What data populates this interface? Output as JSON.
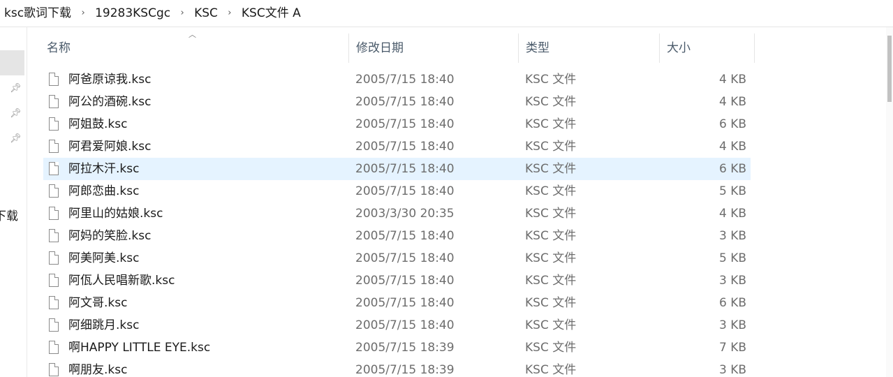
{
  "breadcrumb": {
    "items": [
      "ksc歌词下载",
      "19283KSCgc",
      "KSC",
      "KSC文件 A"
    ],
    "separator": "›"
  },
  "nav": {
    "partial_label": "下载"
  },
  "columns": {
    "name": "名称",
    "date": "修改日期",
    "type": "类型",
    "size": "大小"
  },
  "files": [
    {
      "name": "阿爸原谅我.ksc",
      "date": "2005/7/15 18:40",
      "type": "KSC 文件",
      "size": "4 KB"
    },
    {
      "name": "阿公的酒碗.ksc",
      "date": "2005/7/15 18:40",
      "type": "KSC 文件",
      "size": "4 KB"
    },
    {
      "name": "阿姐鼓.ksc",
      "date": "2005/7/15 18:40",
      "type": "KSC 文件",
      "size": "6 KB"
    },
    {
      "name": "阿君爱阿娘.ksc",
      "date": "2005/7/15 18:40",
      "type": "KSC 文件",
      "size": "4 KB"
    },
    {
      "name": "阿拉木汗.ksc",
      "date": "2005/7/15 18:40",
      "type": "KSC 文件",
      "size": "6 KB",
      "selected": true
    },
    {
      "name": "阿郎恋曲.ksc",
      "date": "2005/7/15 18:40",
      "type": "KSC 文件",
      "size": "5 KB"
    },
    {
      "name": "阿里山的姑娘.ksc",
      "date": "2003/3/30 20:35",
      "type": "KSC 文件",
      "size": "4 KB"
    },
    {
      "name": "阿妈的笑脸.ksc",
      "date": "2005/7/15 18:40",
      "type": "KSC 文件",
      "size": "3 KB"
    },
    {
      "name": "阿美阿美.ksc",
      "date": "2005/7/15 18:40",
      "type": "KSC 文件",
      "size": "5 KB"
    },
    {
      "name": "阿佤人民唱新歌.ksc",
      "date": "2005/7/15 18:40",
      "type": "KSC 文件",
      "size": "3 KB"
    },
    {
      "name": "阿文哥.ksc",
      "date": "2005/7/15 18:40",
      "type": "KSC 文件",
      "size": "6 KB"
    },
    {
      "name": "阿细跳月.ksc",
      "date": "2005/7/15 18:40",
      "type": "KSC 文件",
      "size": "3 KB"
    },
    {
      "name": "啊HAPPY LITTLE EYE.ksc",
      "date": "2005/7/15 18:39",
      "type": "KSC 文件",
      "size": "7 KB"
    },
    {
      "name": "啊朋友.ksc",
      "date": "2005/7/15 18:39",
      "type": "KSC 文件",
      "size": "3 KB"
    }
  ],
  "icons": {
    "file": "document-icon",
    "pin": "pin-icon",
    "sort": "sort-up-icon"
  }
}
